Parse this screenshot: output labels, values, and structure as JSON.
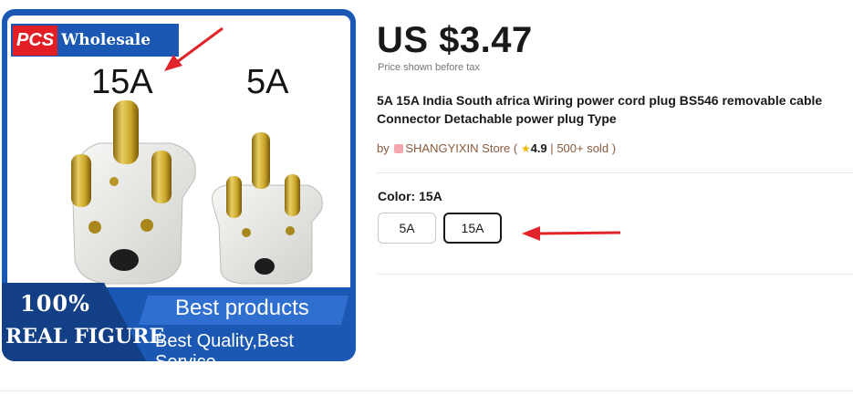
{
  "image": {
    "brand_pcs": "PCS",
    "brand_wholesale": "Wholesale",
    "label_left": "15A",
    "label_right": "5A",
    "badge_top": "100%",
    "badge_bottom": "REAL FIGURE",
    "banner_title": "Best products",
    "banner_subtitle": "Best Quality,Best Service",
    "brand_blue": "#1a58b4",
    "brand_red": "#e11e24"
  },
  "product": {
    "price": "US $3.47",
    "tax_note": "Price shown before tax",
    "title": "5A 15A India South africa Wiring power cord plug BS546 removable cable Connector Detachable power plug Type",
    "store_prefix": "by",
    "store_name": "SHANGYIXIN Store",
    "rating": "4.9",
    "sold": "500+ sold",
    "color_label": "Color: 15A",
    "options": [
      "5A",
      "15A"
    ],
    "selected_option": "15A"
  },
  "annotations": {
    "arrow_color": "#e0242a"
  }
}
